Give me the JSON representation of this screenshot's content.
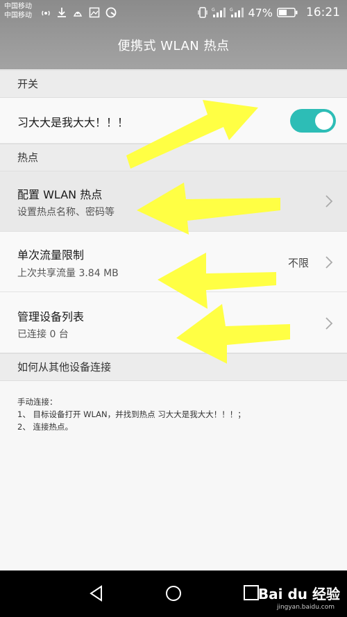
{
  "status_bar": {
    "carrier_1": "中国移动",
    "carrier_2": "中国移动",
    "battery": "47%",
    "time": "16:21",
    "icons_left": [
      "wifi-hotspot-icon",
      "download-icon",
      "app-icon",
      "image-icon",
      "browser-icon"
    ],
    "icons_right": [
      "vibrate-icon",
      "signal-icon",
      "signal-icon",
      "battery-icon"
    ]
  },
  "header": {
    "title": "便携式 WLAN 热点"
  },
  "sections": {
    "switch": "开关",
    "hotspot": "热点",
    "how_to": "如何从其他设备连接"
  },
  "switch_row": {
    "label": "习大大是我大大！！！",
    "on": true,
    "accent": "#2dbdb6"
  },
  "config_row": {
    "title": "配置 WLAN 热点",
    "subtitle": "设置热点名称、密码等"
  },
  "limit_row": {
    "title": "单次流量限制",
    "subtitle": "上次共享流量 3.84 MB",
    "value": "不限"
  },
  "devices_row": {
    "title": "管理设备列表",
    "subtitle": "已连接 0 台"
  },
  "instructions": {
    "line1": "手动连接：",
    "line2": "1、 目标设备打开 WLAN，并找到热点 习大大是我大大！！！；",
    "line3": "2、 连接热点。"
  },
  "nav": {
    "buttons": [
      "back-icon",
      "home-icon",
      "recents-icon"
    ]
  },
  "watermark": {
    "text": "Bai du 经验",
    "sub": "jingyan.baidu.com"
  },
  "annotation_color": "#ffff44"
}
